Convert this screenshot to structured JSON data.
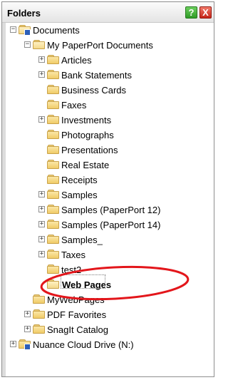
{
  "panel": {
    "title": "Folders",
    "help_icon": "help-icon",
    "close_icon": "close-icon",
    "help_glyph": "?",
    "close_glyph": "X",
    "accent_help": "#2f9a26",
    "accent_close": "#c42418",
    "highlight_color": "#e3161b"
  },
  "tree": {
    "documents": "Documents",
    "my_paperport": "My PaperPort Documents",
    "articles": "Articles",
    "bank_statements": "Bank Statements",
    "business_cards": "Business Cards",
    "faxes": "Faxes",
    "investments": "Investments",
    "photographs": "Photographs",
    "presentations": "Presentations",
    "real_estate": "Real Estate",
    "receipts": "Receipts",
    "samples": "Samples",
    "samples_pp12": "Samples (PaperPort 12)",
    "samples_pp14": "Samples (PaperPort 14)",
    "samples_underscore": "Samples_",
    "taxes": "Taxes",
    "test2": "test2",
    "web_pages": "Web Pages",
    "my_webpages": "MyWebPages",
    "pdf_favorites": "PDF Favorites",
    "snagit_catalog": "SnagIt Catalog",
    "nuance_cloud": "Nuance Cloud Drive (N:)"
  },
  "glyphs": {
    "expand": "+",
    "collapse": "−"
  }
}
